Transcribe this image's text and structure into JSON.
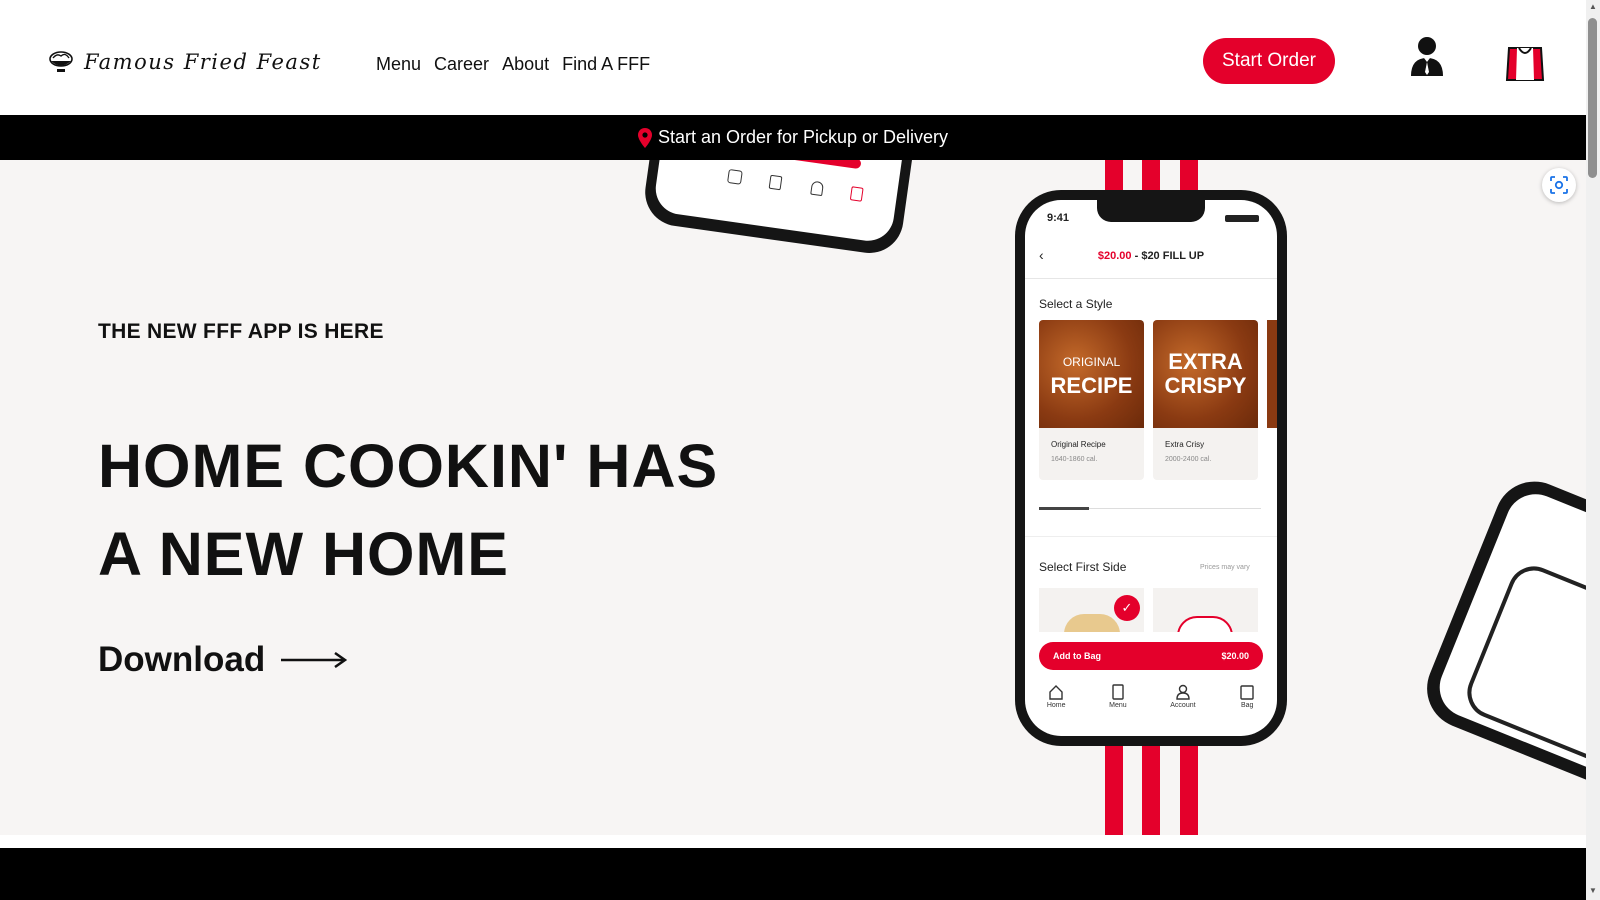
{
  "brand": {
    "name": "Famous Fried Feast"
  },
  "nav": {
    "items": [
      {
        "label": "Menu"
      },
      {
        "label": "Career"
      },
      {
        "label": "About"
      },
      {
        "label": "Find A FFF"
      }
    ]
  },
  "header": {
    "start_order_label": "Start Order"
  },
  "order_bar": {
    "label": "Start an Order for Pickup or Delivery"
  },
  "hero": {
    "eyebrow": "THE NEW FFF APP IS HERE",
    "headline_line1": "HOME COOKIN' HAS",
    "headline_line2": "A NEW HOME",
    "download_label": "Download"
  },
  "phone": {
    "time": "9:41",
    "price": "$20.00",
    "title": " - $20 FILL UP",
    "select_style": "Select a Style",
    "style_cards": [
      {
        "image_top": "ORIGINAL",
        "image_bottom": "RECIPE",
        "name": "Original Recipe",
        "cal": "1640-1860 cal."
      },
      {
        "image_top": "EXTRA",
        "image_bottom": "CRISPY",
        "name": "Extra Crisy",
        "cal": "2000-2400 cal."
      }
    ],
    "select_side": "Select First Side",
    "prices_note": "Prices may vary",
    "add_to_bag": "Add to Bag",
    "add_price": "$20.00",
    "tabs": [
      {
        "label": "Home"
      },
      {
        "label": "Menu"
      },
      {
        "label": "Account"
      },
      {
        "label": "Bag"
      }
    ]
  },
  "colors": {
    "accent": "#e4002b",
    "dark": "#000000",
    "hero_bg": "#f7f5f4"
  },
  "icons": [
    "logo-bowl-icon",
    "account-icon",
    "bag-icon",
    "location-pin-icon",
    "arrow-right-icon",
    "lens-icon"
  ]
}
